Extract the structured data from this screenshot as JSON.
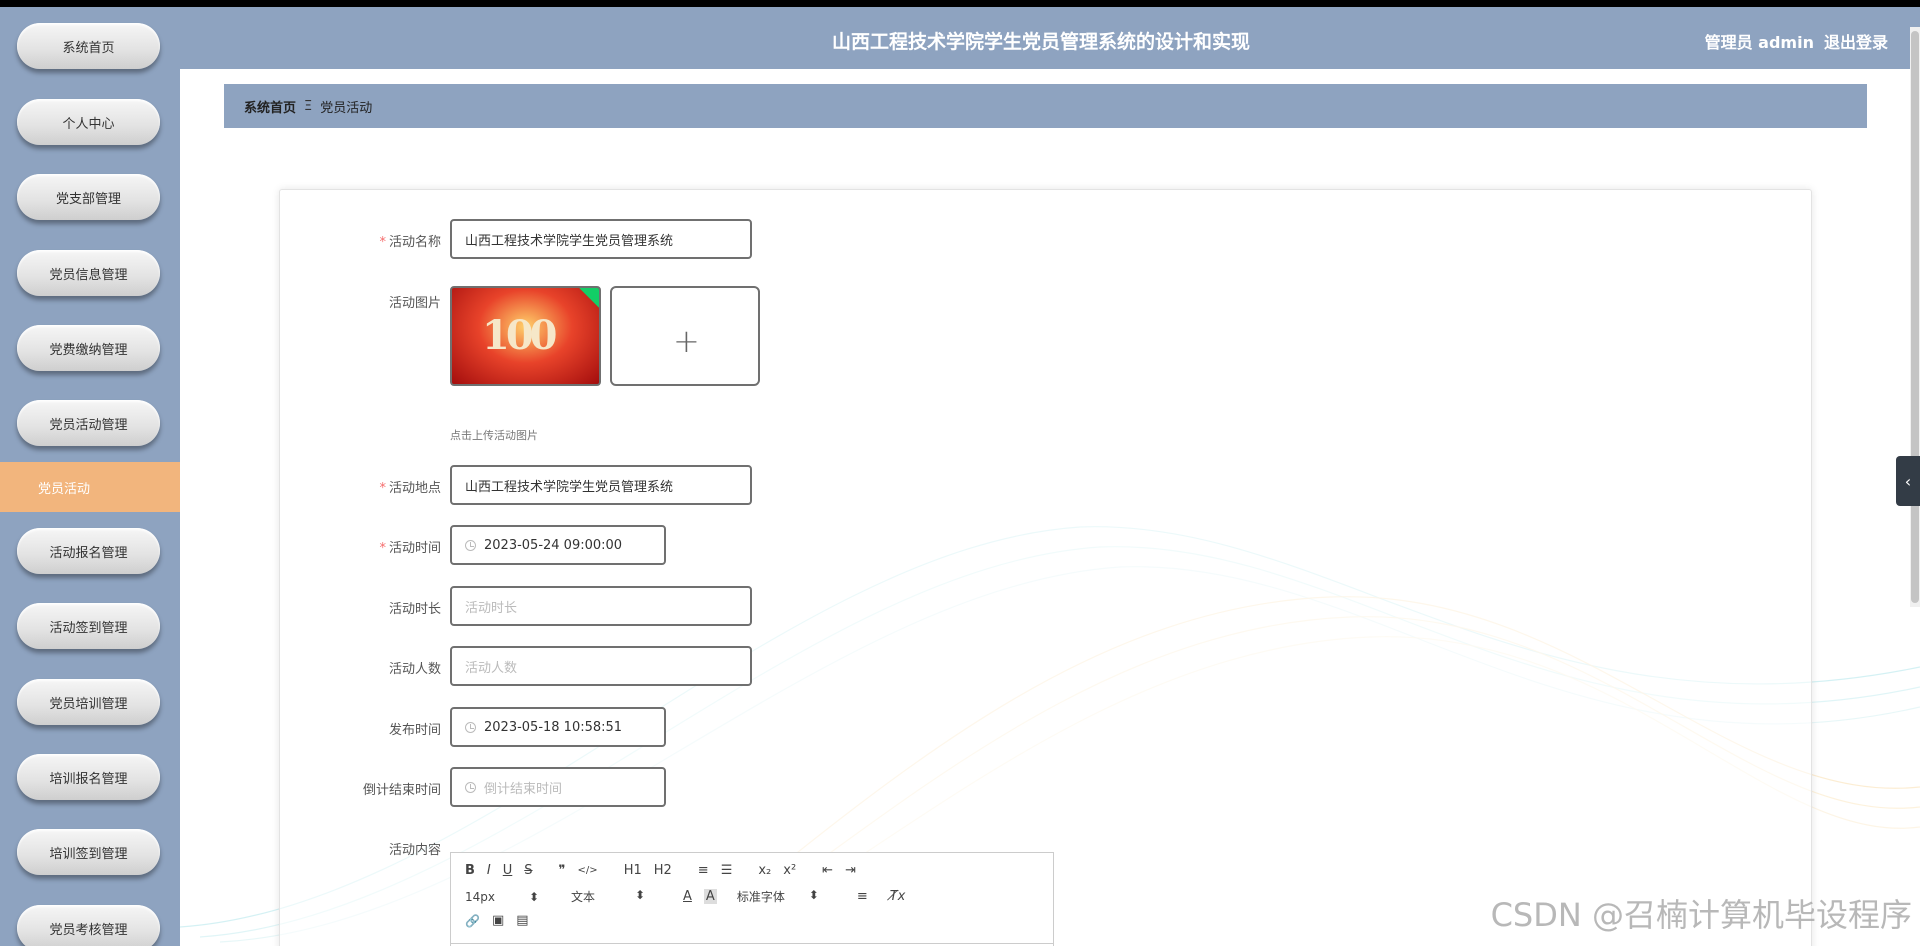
{
  "sidebar": {
    "items": [
      {
        "label": "系统首页"
      },
      {
        "label": "个人中心"
      },
      {
        "label": "党支部管理"
      },
      {
        "label": "党员信息管理"
      },
      {
        "label": "党费缴纳管理"
      },
      {
        "label": "党员活动管理"
      },
      {
        "label": "活动报名管理"
      },
      {
        "label": "活动签到管理"
      },
      {
        "label": "党员培训管理"
      },
      {
        "label": "培训报名管理"
      },
      {
        "label": "培训签到管理"
      },
      {
        "label": "党员考核管理"
      }
    ],
    "active_sub": "党员活动"
  },
  "header": {
    "title": "山西工程技术学院学生党员管理系统的设计和实现",
    "user": "管理员 admin",
    "logout": "退出登录"
  },
  "breadcrumb": {
    "home": "系统首页",
    "separator": "Ξ",
    "current": "党员活动"
  },
  "form": {
    "name": {
      "label": "活动名称",
      "value": "山西工程技术学院学生党员管理系统",
      "required": true
    },
    "image": {
      "label": "活动图片",
      "thumb_text": "100",
      "hint": "点击上传活动图片"
    },
    "location": {
      "label": "活动地点",
      "value": "山西工程技术学院学生党员管理系统",
      "required": true
    },
    "time": {
      "label": "活动时间",
      "value": "2023-05-24 09:00:00",
      "required": true
    },
    "duration": {
      "label": "活动时长",
      "placeholder": "活动时长"
    },
    "count": {
      "label": "活动人数",
      "placeholder": "活动人数"
    },
    "publish": {
      "label": "发布时间",
      "value": "2023-05-18 10:58:51"
    },
    "countdown": {
      "label": "倒计结束时间",
      "placeholder": "倒计结束时间"
    },
    "content": {
      "label": "活动内容"
    }
  },
  "editor": {
    "row1": [
      "B",
      "I",
      "U",
      "S",
      "❞",
      "</>",
      "H1",
      "H2",
      "≡",
      "☰",
      "x₂",
      "x²",
      "⇤",
      "⇥"
    ],
    "font_size": "14px",
    "paragraph": "文本",
    "font_family": "标准字体",
    "align": "≡",
    "clear": "T̸x",
    "row3": [
      "🔗",
      "▣",
      "▤"
    ]
  },
  "required_mark": "*",
  "watermark": "CSDN @召楠计算机毕设程序",
  "colors": {
    "sidebar": "#8ea3c0",
    "active": "#f2b57d",
    "required": "#f56c6c"
  }
}
